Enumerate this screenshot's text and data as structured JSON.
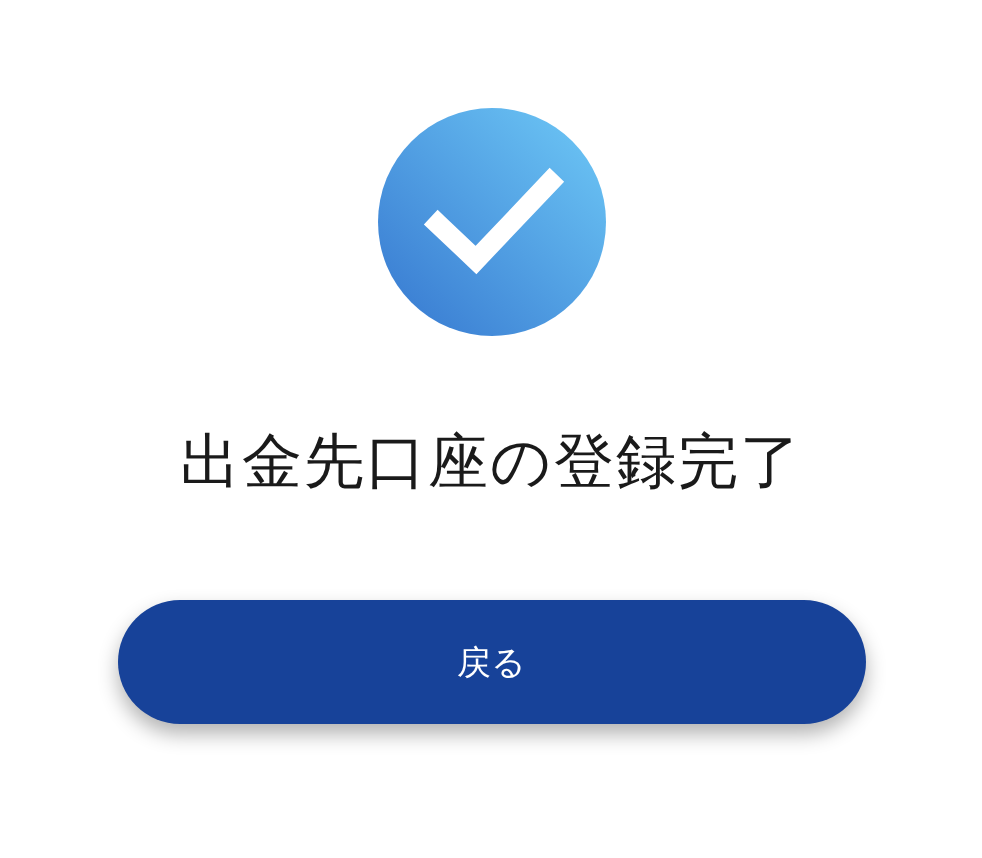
{
  "title": "出金先口座の登録完了",
  "buttons": [
    {
      "label": "戻る"
    }
  ]
}
